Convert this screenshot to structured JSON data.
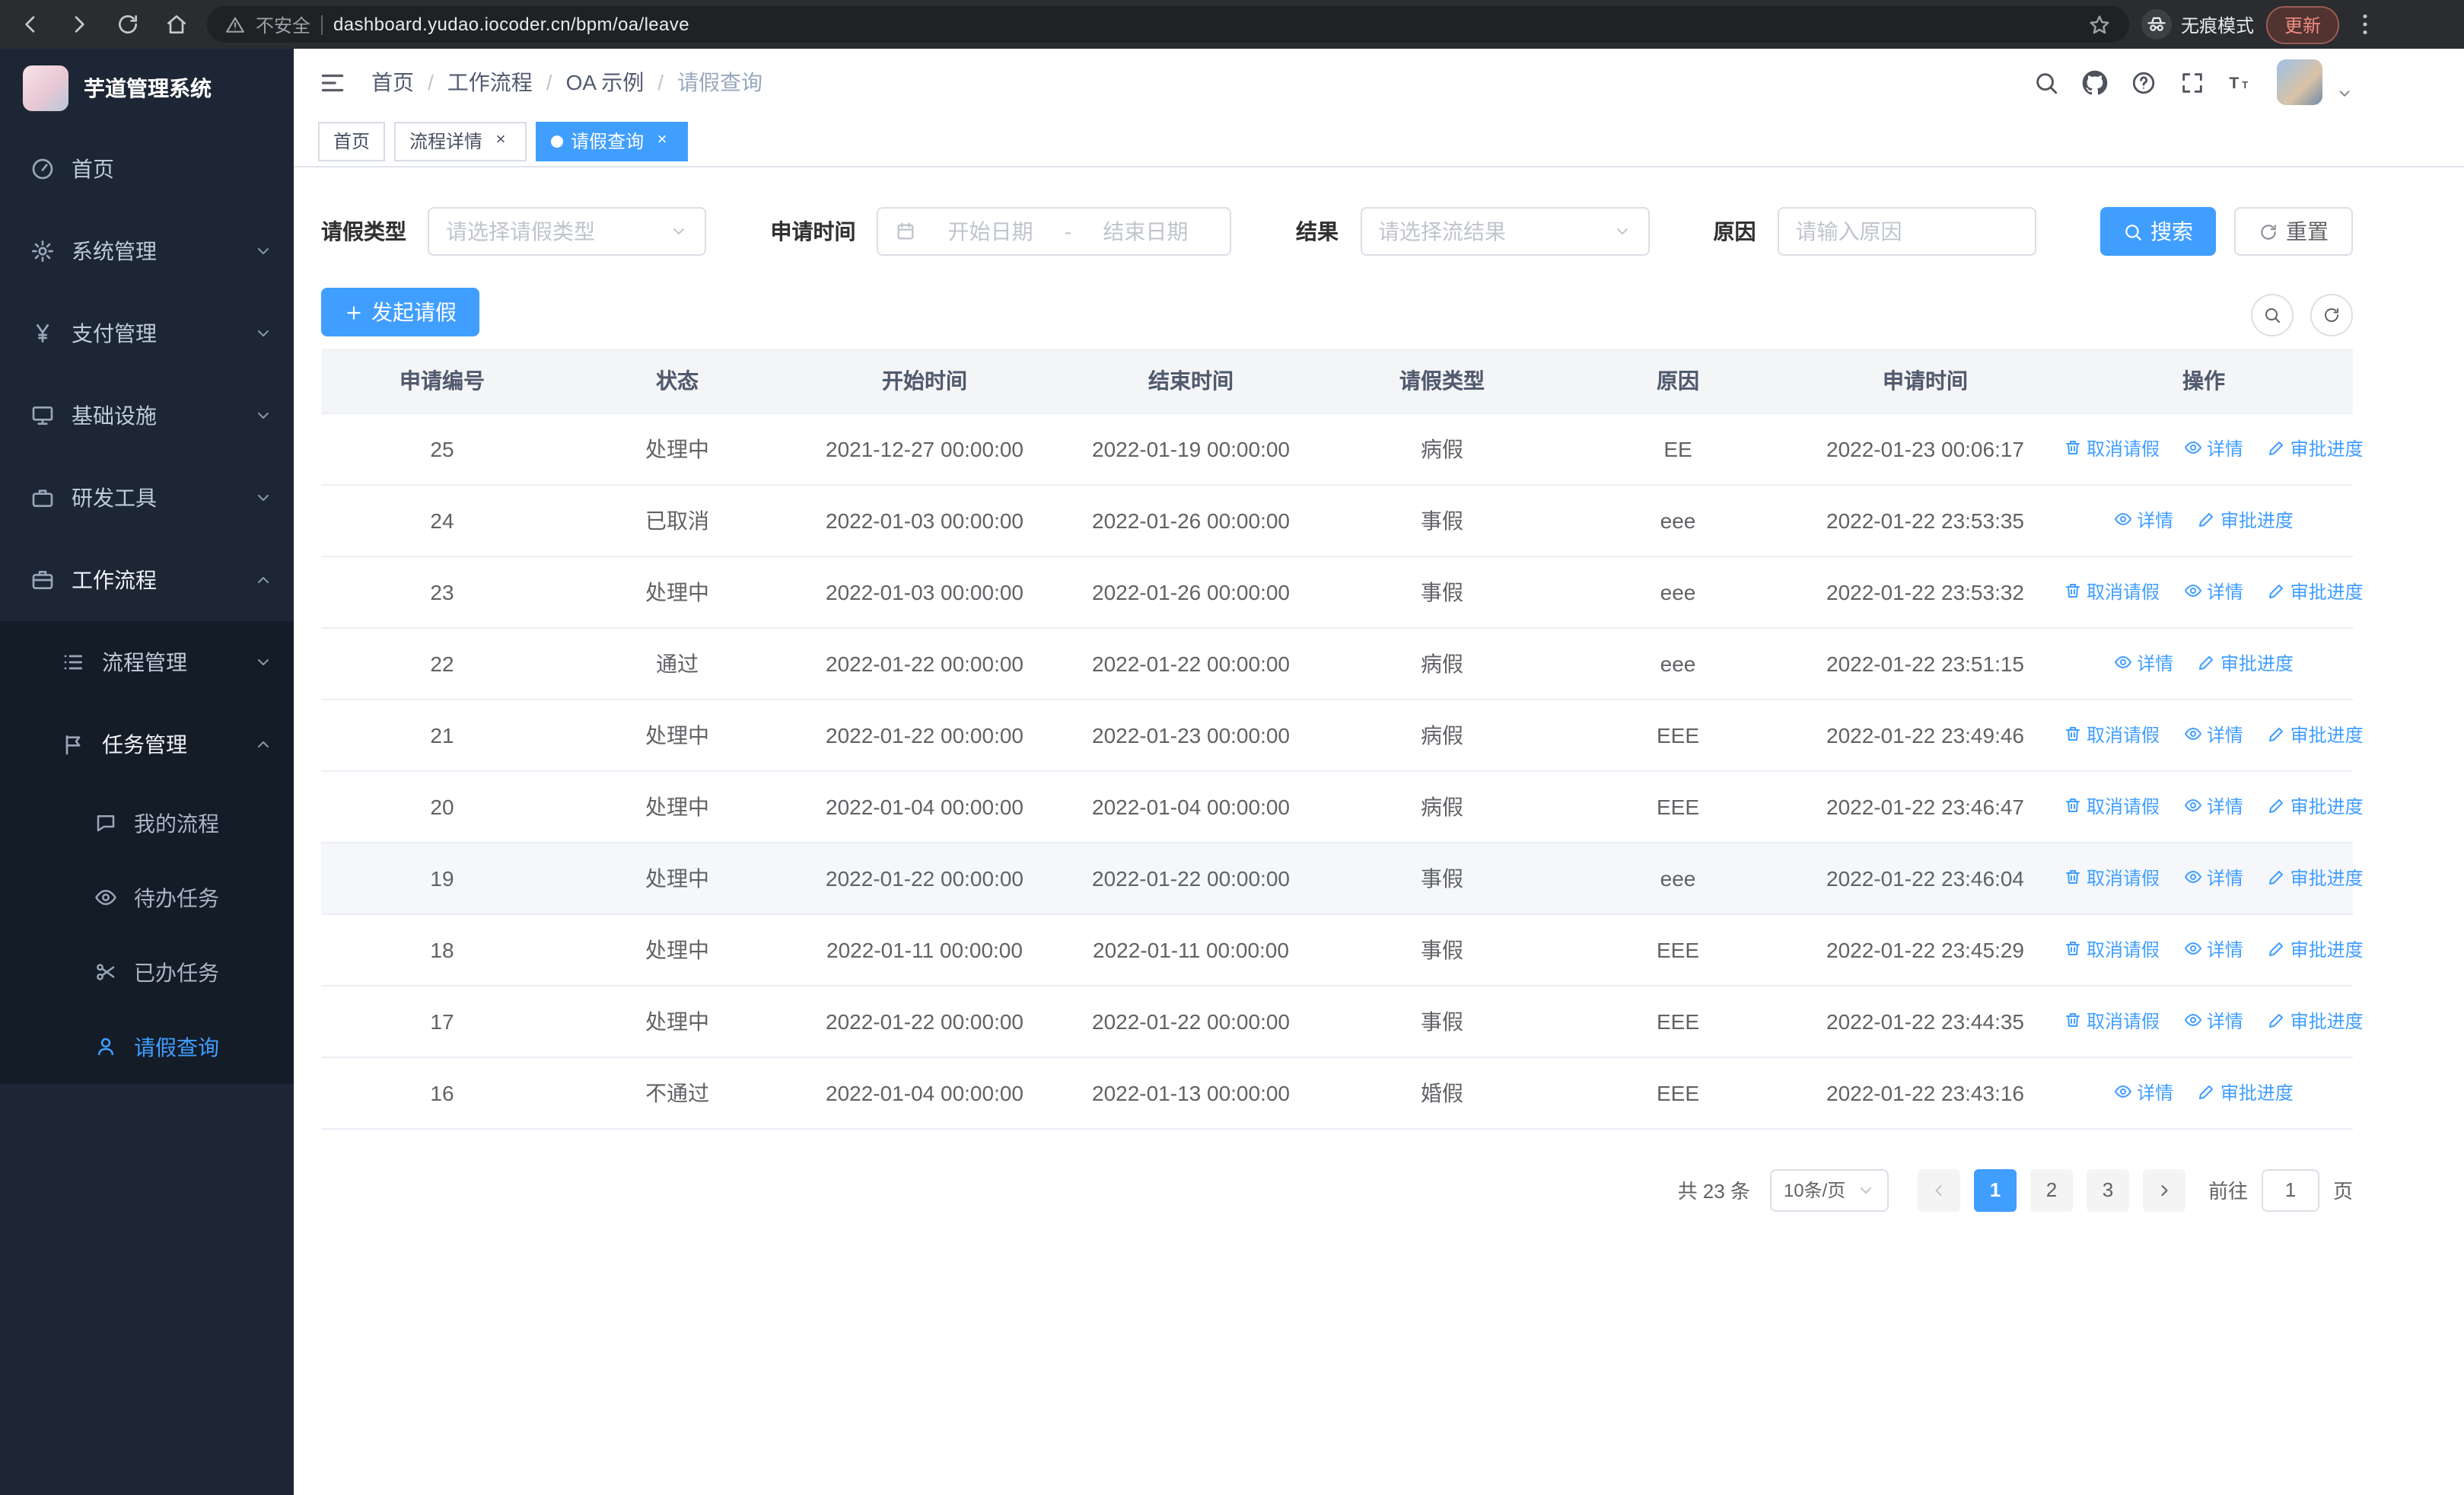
{
  "colors": {
    "primary": "#409eff",
    "sidebar_bg": "#1d2634",
    "sidebar_sub_bg": "#141c28",
    "update_accent": "#f28b82"
  },
  "browser": {
    "nav_icons": [
      {
        "icon": "back",
        "name": "back-button"
      },
      {
        "icon": "forward",
        "name": "forward-button"
      },
      {
        "icon": "refresh",
        "name": "reload-button"
      },
      {
        "icon": "home",
        "name": "home-button"
      }
    ],
    "security_warning": "不安全",
    "url": "dashboard.yudao.iocoder.cn/bpm/oa/leave",
    "incognito_label": "无痕模式",
    "update_label": "更新"
  },
  "sidebar": {
    "logo_title": "芋道管理系统",
    "items": [
      {
        "name": "home",
        "label": "首页",
        "icon": "dashboard",
        "level": 1
      },
      {
        "name": "system-management",
        "label": "系统管理",
        "icon": "gear",
        "level": 1,
        "arrow": "down"
      },
      {
        "name": "payment-management",
        "label": "支付管理",
        "icon": "yen",
        "level": 1,
        "arrow": "down"
      },
      {
        "name": "infrastructure",
        "label": "基础设施",
        "icon": "monitor",
        "level": 1,
        "arrow": "down"
      },
      {
        "name": "dev-tools",
        "label": "研发工具",
        "icon": "toolbox",
        "level": 1,
        "arrow": "down"
      },
      {
        "name": "workflow",
        "label": "工作流程",
        "icon": "briefcase",
        "level": 1,
        "arrow": "up",
        "expanded": true
      },
      {
        "name": "process-management",
        "label": "流程管理",
        "icon": "list",
        "level": 2,
        "arrow": "down"
      },
      {
        "name": "task-management",
        "label": "任务管理",
        "icon": "flag",
        "level": 2,
        "arrow": "up",
        "expanded": true
      },
      {
        "name": "my-process",
        "label": "我的流程",
        "icon": "chat",
        "level": 3
      },
      {
        "name": "todo-task",
        "label": "待办任务",
        "icon": "eye",
        "level": 3
      },
      {
        "name": "done-task",
        "label": "已办任务",
        "icon": "scissors",
        "level": 3
      },
      {
        "name": "leave-query",
        "label": "请假查询",
        "icon": "user",
        "level": 3,
        "active": true
      }
    ]
  },
  "header": {
    "breadcrumb": [
      "首页",
      "工作流程",
      "OA 示例",
      "请假查询"
    ],
    "separator": "/",
    "icons": [
      {
        "icon": "search",
        "name": "search-icon"
      },
      {
        "icon": "github",
        "name": "github-icon"
      },
      {
        "icon": "question",
        "name": "help-icon"
      },
      {
        "icon": "fullscreen",
        "name": "fullscreen-icon"
      },
      {
        "icon": "font-size",
        "name": "font-size-icon"
      }
    ]
  },
  "tabs": [
    {
      "name": "home",
      "label": "首页",
      "closable": false,
      "active": false
    },
    {
      "name": "process-detail",
      "label": "流程详情",
      "closable": true,
      "active": false
    },
    {
      "name": "leave-query",
      "label": "请假查询",
      "closable": true,
      "active": true
    }
  ],
  "filters": {
    "leave_type_label": "请假类型",
    "leave_type_placeholder": "请选择请假类型",
    "apply_time_label": "申请时间",
    "start_date_placeholder": "开始日期",
    "date_separator": "-",
    "end_date_placeholder": "结束日期",
    "result_label": "结果",
    "result_placeholder": "请选择流结果",
    "reason_label": "原因",
    "reason_placeholder": "请输入原因",
    "search_label": "搜索",
    "reset_label": "重置"
  },
  "toolbar": {
    "create_label": "发起请假",
    "mini_buttons": [
      {
        "icon": "search",
        "name": "toggle-search-button"
      },
      {
        "icon": "refresh",
        "name": "refresh-table-button"
      }
    ]
  },
  "table": {
    "columns": [
      "申请编号",
      "状态",
      "开始时间",
      "结束时间",
      "请假类型",
      "原因",
      "申请时间",
      "操作"
    ],
    "actions": {
      "cancel": "取消请假",
      "detail": "详情",
      "progress": "审批进度"
    },
    "rows": [
      {
        "id": "25",
        "status": "处理中",
        "start": "2021-12-27 00:00:00",
        "end": "2022-01-19 00:00:00",
        "type": "病假",
        "reason": "EE",
        "apply_time": "2022-01-23 00:06:17",
        "cancelable": true
      },
      {
        "id": "24",
        "status": "已取消",
        "start": "2022-01-03 00:00:00",
        "end": "2022-01-26 00:00:00",
        "type": "事假",
        "reason": "eee",
        "apply_time": "2022-01-22 23:53:35",
        "cancelable": false
      },
      {
        "id": "23",
        "status": "处理中",
        "start": "2022-01-03 00:00:00",
        "end": "2022-01-26 00:00:00",
        "type": "事假",
        "reason": "eee",
        "apply_time": "2022-01-22 23:53:32",
        "cancelable": true
      },
      {
        "id": "22",
        "status": "通过",
        "start": "2022-01-22 00:00:00",
        "end": "2022-01-22 00:00:00",
        "type": "病假",
        "reason": "eee",
        "apply_time": "2022-01-22 23:51:15",
        "cancelable": false
      },
      {
        "id": "21",
        "status": "处理中",
        "start": "2022-01-22 00:00:00",
        "end": "2022-01-23 00:00:00",
        "type": "病假",
        "reason": "EEE",
        "apply_time": "2022-01-22 23:49:46",
        "cancelable": true
      },
      {
        "id": "20",
        "status": "处理中",
        "start": "2022-01-04 00:00:00",
        "end": "2022-01-04 00:00:00",
        "type": "病假",
        "reason": "EEE",
        "apply_time": "2022-01-22 23:46:47",
        "cancelable": true
      },
      {
        "id": "19",
        "status": "处理中",
        "start": "2022-01-22 00:00:00",
        "end": "2022-01-22 00:00:00",
        "type": "事假",
        "reason": "eee",
        "apply_time": "2022-01-22 23:46:04",
        "cancelable": true,
        "hovered": true
      },
      {
        "id": "18",
        "status": "处理中",
        "start": "2022-01-11 00:00:00",
        "end": "2022-01-11 00:00:00",
        "type": "事假",
        "reason": "EEE",
        "apply_time": "2022-01-22 23:45:29",
        "cancelable": true
      },
      {
        "id": "17",
        "status": "处理中",
        "start": "2022-01-22 00:00:00",
        "end": "2022-01-22 00:00:00",
        "type": "事假",
        "reason": "EEE",
        "apply_time": "2022-01-22 23:44:35",
        "cancelable": true
      },
      {
        "id": "16",
        "status": "不通过",
        "start": "2022-01-04 00:00:00",
        "end": "2022-01-13 00:00:00",
        "type": "婚假",
        "reason": "EEE",
        "apply_time": "2022-01-22 23:43:16",
        "cancelable": false
      }
    ]
  },
  "pagination": {
    "total_label": "共 23 条",
    "page_size": "10条/页",
    "pages": [
      "1",
      "2",
      "3"
    ],
    "active_page": "1",
    "goto_label": "前往",
    "goto_value": "1",
    "page_unit": "页"
  }
}
